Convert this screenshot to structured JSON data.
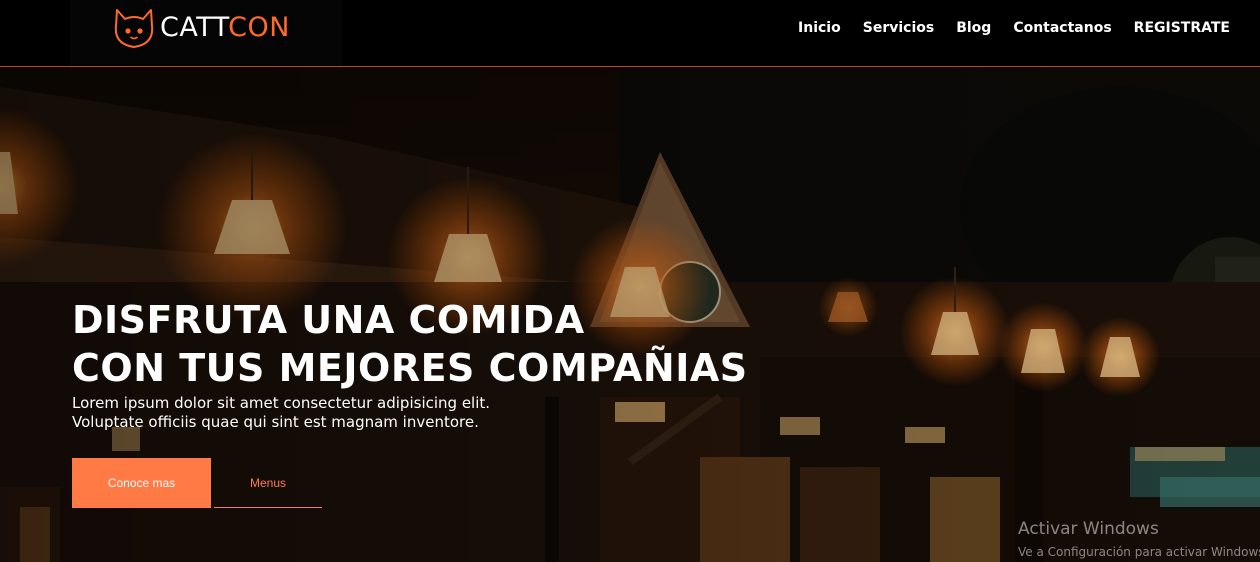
{
  "brand": {
    "name_part1": "CATT",
    "name_part2": "CON",
    "logo_icon": "cat-face-icon",
    "accent_color": "#ff6a2b"
  },
  "nav": {
    "items": [
      {
        "label": "Inicio"
      },
      {
        "label": "Servicios"
      },
      {
        "label": "Blog"
      },
      {
        "label": "Contactanos"
      },
      {
        "label": "REGISTRATE"
      }
    ]
  },
  "hero": {
    "title_line1": "DISFRUTA UNA COMIDA",
    "title_line2": "CON TUS MEJORES COMPAÑIAS",
    "subtitle_line1": "Lorem ipsum dolor sit amet consectetur adipisicing elit.",
    "subtitle_line2": "Voluptate officiis quae qui sint est magnam inventore.",
    "primary_button": "Conoce mas",
    "secondary_button": "Menus",
    "button_color": "#ff7a45"
  },
  "watermark": {
    "title": "Activar Windows",
    "subtitle": "Ve a Configuración para activar Windows."
  }
}
